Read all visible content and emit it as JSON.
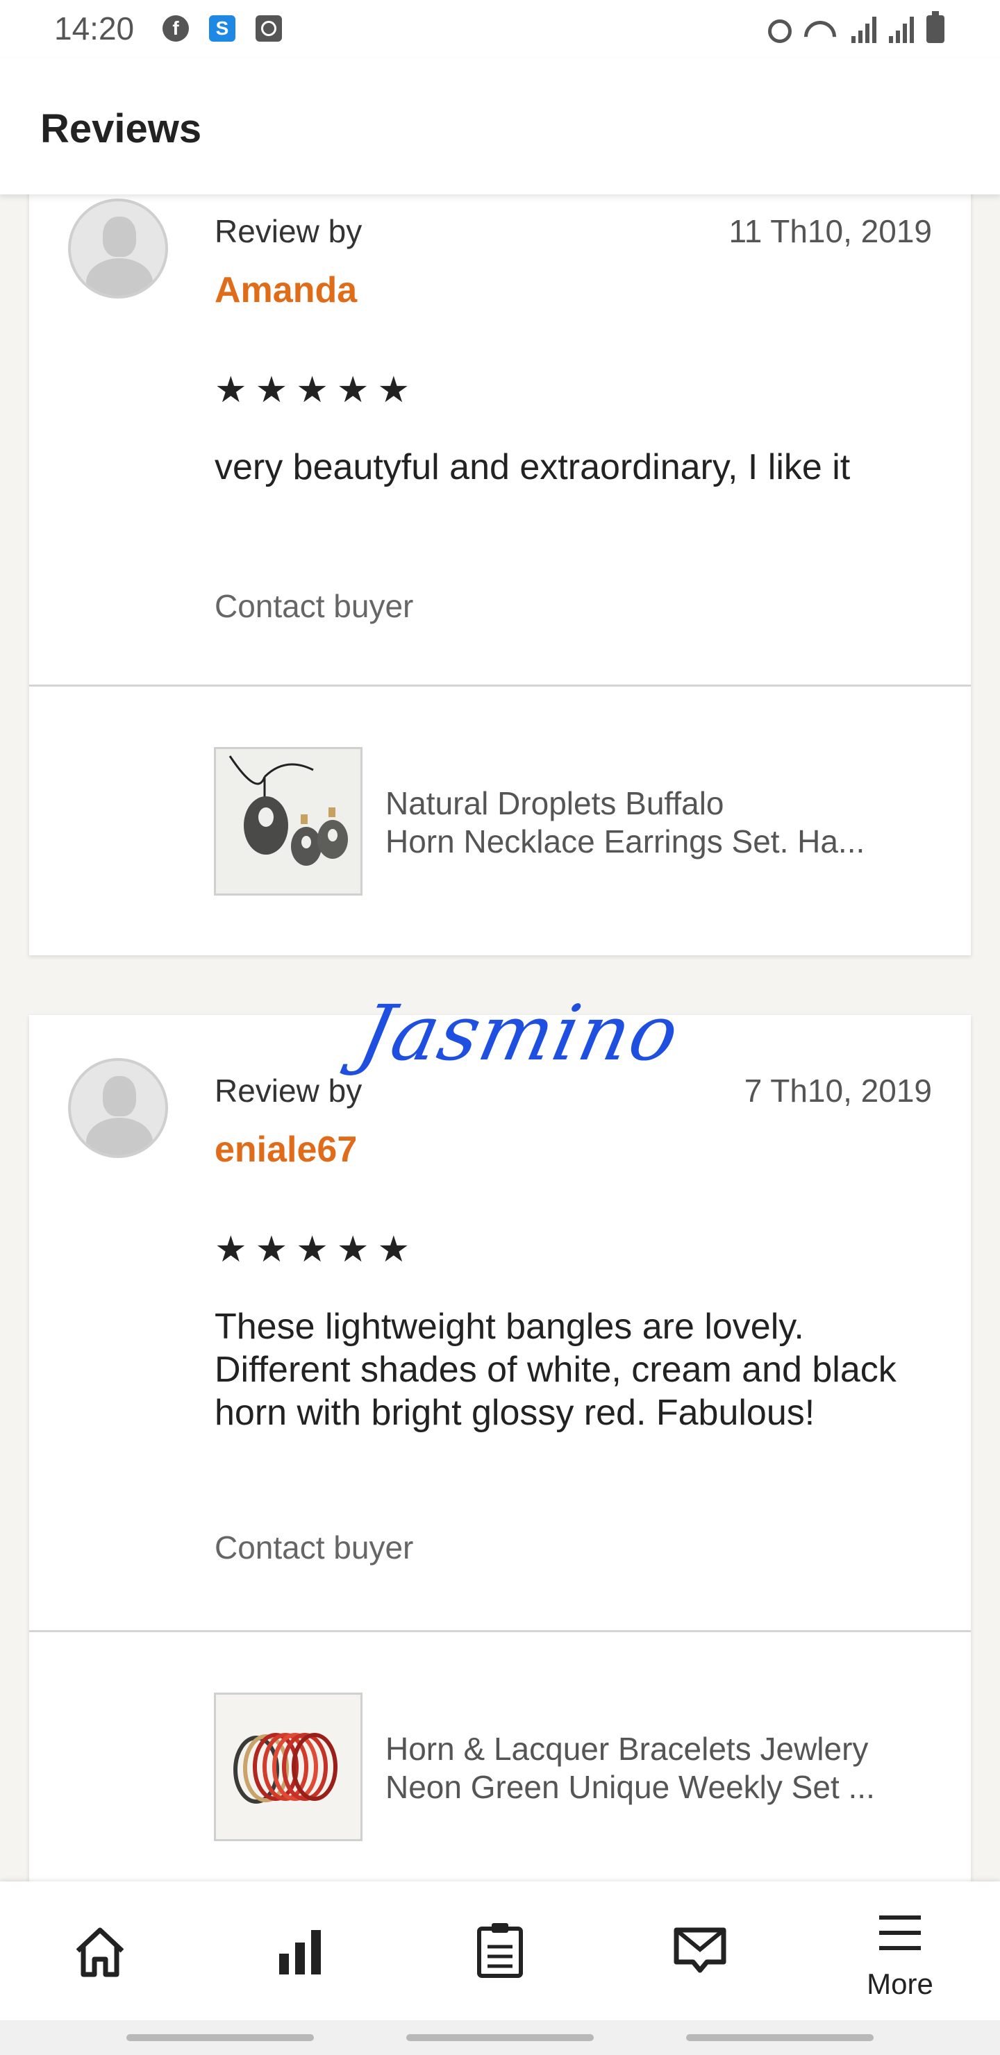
{
  "status_bar": {
    "time": "14:20",
    "left_icons": [
      "facebook-icon",
      "s-app-icon",
      "clock-app-icon"
    ],
    "right_icons": [
      "alarm-icon",
      "wifi-icon",
      "signal-icon",
      "signal-icon",
      "battery-icon"
    ]
  },
  "header": {
    "title": "Reviews"
  },
  "reviews": [
    {
      "review_by_label": "Review by",
      "reviewer": "Amanda",
      "date": "11 Th10, 2019",
      "stars": "★★★★★",
      "rating": 5,
      "text": "very beautyful and extraordinary, I like it",
      "contact_label": "Contact buyer",
      "product": {
        "title_line1": "Natural Droplets Buffalo",
        "title_line2": "Horn Necklace Earrings Set. Ha..."
      }
    },
    {
      "review_by_label": "Review by",
      "reviewer": "eniale67",
      "date": "7 Th10, 2019",
      "stars": "★★★★★",
      "rating": 5,
      "text": "These lightweight bangles are lovely. Different shades of white, cream and black horn with bright glossy red. Fabulous!",
      "contact_label": "Contact buyer",
      "product": {
        "title_line1": "Horn & Lacquer Bracelets Jewlery",
        "title_line2": "Neon Green Unique Weekly Set ..."
      }
    }
  ],
  "signature": "Jasmino",
  "bottom_nav": [
    {
      "icon": "home-icon"
    },
    {
      "icon": "stats-icon"
    },
    {
      "icon": "orders-icon"
    },
    {
      "icon": "messages-icon"
    },
    {
      "icon": "menu-icon",
      "label": "More"
    }
  ],
  "colors": {
    "accent": "#e06c1a",
    "signature": "#1f4fe0",
    "background": "#f5f4f1"
  }
}
